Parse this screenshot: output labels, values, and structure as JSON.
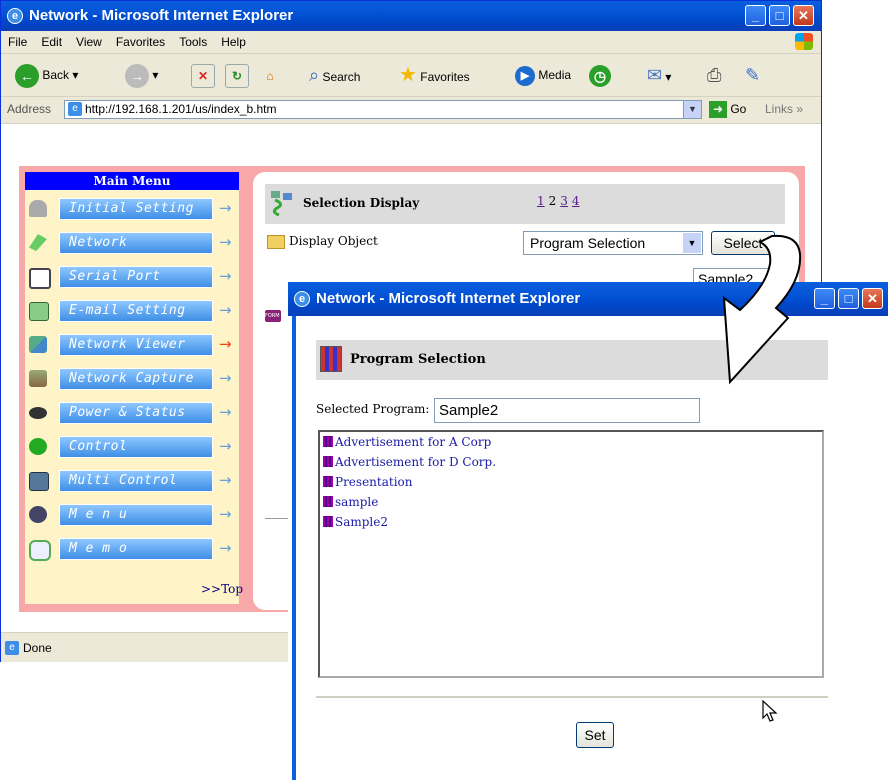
{
  "main_window": {
    "title": "Network - Microsoft Internet Explorer",
    "menu": [
      "File",
      "Edit",
      "View",
      "Favorites",
      "Tools",
      "Help"
    ],
    "toolbar": {
      "back": "Back",
      "search": "Search",
      "favorites": "Favorites",
      "media": "Media"
    },
    "address_label": "Address",
    "url": "http://192.168.1.201/us/index_b.htm",
    "go": "Go",
    "links": "Links",
    "status": "Done"
  },
  "side_menu": {
    "header": "Main Menu",
    "items": [
      {
        "label": "Initial Setting",
        "icon": "lock-icon"
      },
      {
        "label": "Network",
        "icon": "network-icon"
      },
      {
        "label": "Serial Port",
        "icon": "serial-port-icon"
      },
      {
        "label": "E-mail Setting",
        "icon": "email-icon"
      },
      {
        "label": "Network Viewer",
        "icon": "network-viewer-icon"
      },
      {
        "label": "Network Capture",
        "icon": "capture-icon"
      },
      {
        "label": "Power & Status",
        "icon": "power-icon"
      },
      {
        "label": "Control",
        "icon": "control-icon"
      },
      {
        "label": "Multi Control",
        "icon": "multi-control-icon"
      },
      {
        "label": "M e n u",
        "icon": "menu-icon"
      },
      {
        "label": "M e m o",
        "icon": "memo-icon"
      }
    ],
    "to_top": ">>Top"
  },
  "selection_display": {
    "title": "Selection Display",
    "pages": [
      "1",
      "2",
      "3",
      "4"
    ],
    "current_page": "2",
    "display_object_label": "Display Object",
    "dropdown_value": "Program Selection",
    "select_button": "Select",
    "text_value": "Sample2"
  },
  "popup": {
    "title": "Network - Microsoft Internet Explorer",
    "header": "Program Selection",
    "selected_label": "Selected Program:",
    "selected_value": "Sample2",
    "programs": [
      "Advertisement for A Corp",
      "Advertisement for D Corp.",
      "Presentation",
      "sample",
      "Sample2"
    ],
    "set_button": "Set"
  },
  "colors": {
    "title_blue": "#0a5fde",
    "menu_header": "#0000ff",
    "menu_bg": "#fff3c8",
    "panel_pink": "#f8a8a8"
  }
}
